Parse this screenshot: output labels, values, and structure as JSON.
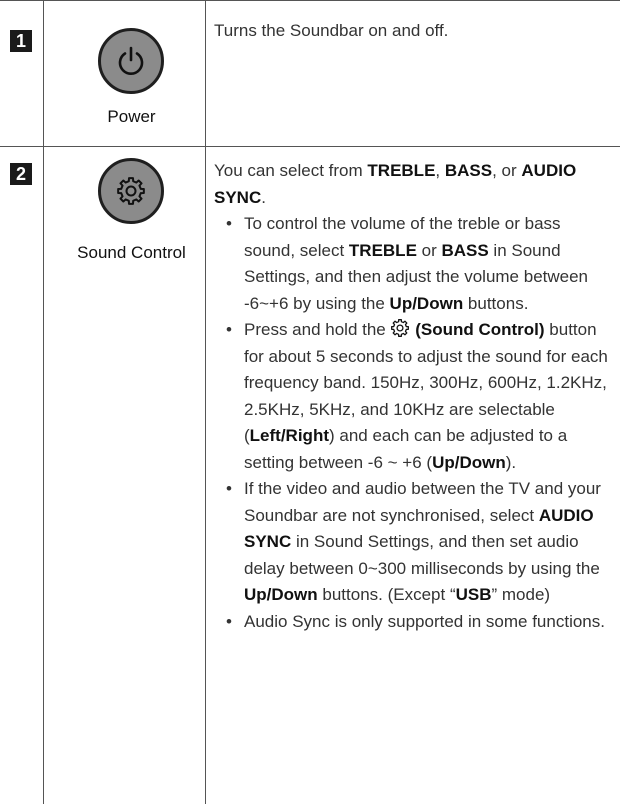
{
  "rows": [
    {
      "number": "1",
      "icon": "power-icon",
      "label": "Power",
      "description": "Turns the Soundbar on and off."
    },
    {
      "number": "2",
      "icon": "gear-icon",
      "label": "Sound Control",
      "intro": [
        {
          "t": "You can select from "
        },
        {
          "t": "TREBLE",
          "b": true
        },
        {
          "t": ", "
        },
        {
          "t": "BASS",
          "b": true
        },
        {
          "t": ", or "
        },
        {
          "t": "AUDIO SYNC",
          "b": true
        },
        {
          "t": "."
        }
      ],
      "bullets": [
        [
          {
            "t": "To control the volume of the treble or bass sound, select "
          },
          {
            "t": "TREBLE",
            "b": true
          },
          {
            "t": " or "
          },
          {
            "t": "BASS",
            "b": true
          },
          {
            "t": " in Sound Settings, and then adjust the volume between -6~+6 by using the "
          },
          {
            "t": "Up/Down",
            "b": true
          },
          {
            "t": " buttons."
          }
        ],
        [
          {
            "t": "Press and hold the "
          },
          {
            "icon": "gear-icon"
          },
          {
            "t": " (Sound Control)",
            "b": true
          },
          {
            "t": " button for about 5 seconds to adjust the sound for each frequency band. 150Hz, 300Hz, 600Hz, 1.2KHz, 2.5KHz, 5KHz, and 10KHz are selectable ("
          },
          {
            "t": "Left/Right",
            "b": true
          },
          {
            "t": ") and each can be adjusted to a setting between -6 ~ +6 ("
          },
          {
            "t": "Up/Down",
            "b": true
          },
          {
            "t": ")."
          }
        ],
        [
          {
            "t": "If the video and audio between the TV and your Soundbar are not synchronised, select "
          },
          {
            "t": "AUDIO SYNC",
            "b": true
          },
          {
            "t": " in Sound Settings, and then set audio delay between 0~300 milliseconds by using the "
          },
          {
            "t": "Up/Down",
            "b": true
          },
          {
            "t": " buttons. (Except “"
          },
          {
            "t": "USB",
            "b": true
          },
          {
            "t": "” mode)"
          }
        ],
        [
          {
            "t": "Audio Sync is only supported in some functions."
          }
        ]
      ]
    }
  ]
}
